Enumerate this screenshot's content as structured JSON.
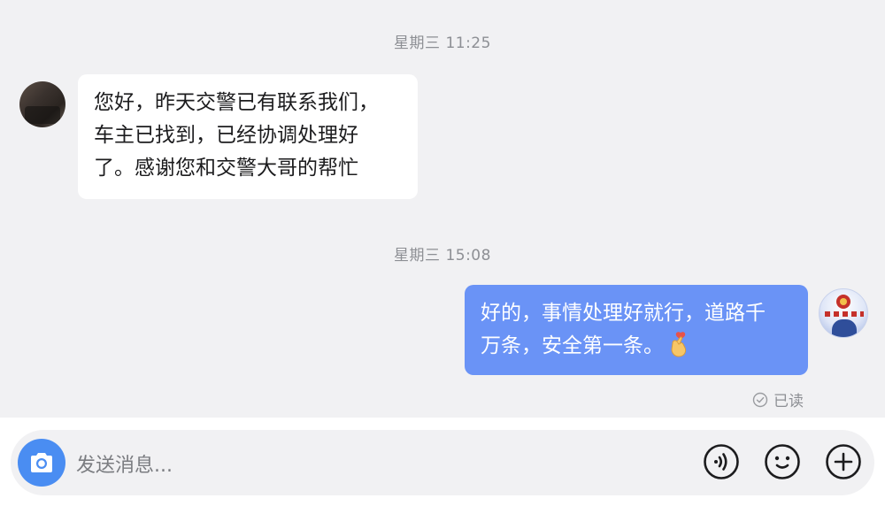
{
  "messages": [
    {
      "timestamp": "星期三 11:25",
      "sender": "other",
      "lines": [
        "您好，昨天交警已有联系我们，",
        "车主已找到，已经协调处理好",
        "了。感谢您和交警大哥的帮忙"
      ]
    },
    {
      "timestamp": "星期三 15:08",
      "sender": "self",
      "lines": [
        "好的，事情处理好就行，道路千",
        "万条，安全第一条。"
      ],
      "emoji": "finger-heart-icon",
      "status": "已读"
    }
  ],
  "input": {
    "placeholder": "发送消息..."
  },
  "colors": {
    "background": "#f1f1f3",
    "self_bubble": "#6a93f6",
    "other_bubble": "#ffffff",
    "camera_button": "#4a8df2"
  },
  "icons": [
    "camera-icon",
    "voice-icon",
    "emoji-face-icon",
    "plus-icon",
    "read-check-icon"
  ]
}
